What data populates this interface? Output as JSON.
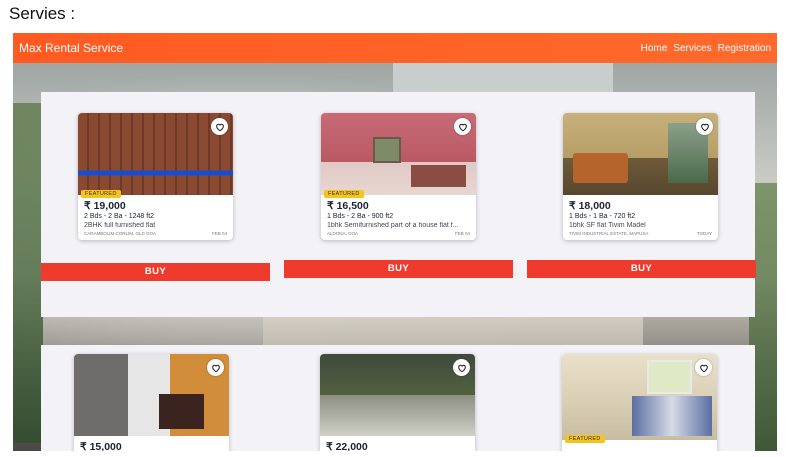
{
  "page": {
    "heading": "Servies :"
  },
  "navbar": {
    "brand": "Max Rental Service",
    "links": [
      "Home",
      "Services",
      "Registration"
    ],
    "color": "#ff5a22"
  },
  "buy_label": "BUY",
  "listings": [
    {
      "featured": "FEATURED",
      "price": "₹ 19,000",
      "specs": "2 Bds - 2 Ba - 1248 ft2",
      "title": "2BHK full furnished flat",
      "location": "CARAMBOLIM CORLIM, OLD GOA",
      "date": "FEB 04"
    },
    {
      "featured": "FEATURED",
      "price": "₹ 16,500",
      "specs": "1 Bds - 2 Ba - 900 ft2",
      "title": "1bhk Semifurnished part of a house flat f...",
      "location": "ALDONA, GOA",
      "date": "FEB 04"
    },
    {
      "featured": "",
      "price": "₹ 18,000",
      "specs": "1 Bds - 1 Ba - 720 ft2",
      "title": "1bhk SF flat Tivim Madel",
      "location": "TIVIM INDUSTRIAL ESTATE, MAPUSA",
      "date": "TODAY"
    },
    {
      "featured": "",
      "price": "₹ 15,000",
      "specs": "",
      "title": "",
      "location": "",
      "date": ""
    },
    {
      "featured": "",
      "price": "₹ 22,000",
      "specs": "",
      "title": "",
      "location": "",
      "date": ""
    },
    {
      "featured": "FEATURED",
      "price": "",
      "specs": "",
      "title": "",
      "location": "",
      "date": ""
    }
  ],
  "colors": {
    "buy": "#ef3b2e",
    "featured": "#f7c31d",
    "panel": "#f3f2f7"
  }
}
